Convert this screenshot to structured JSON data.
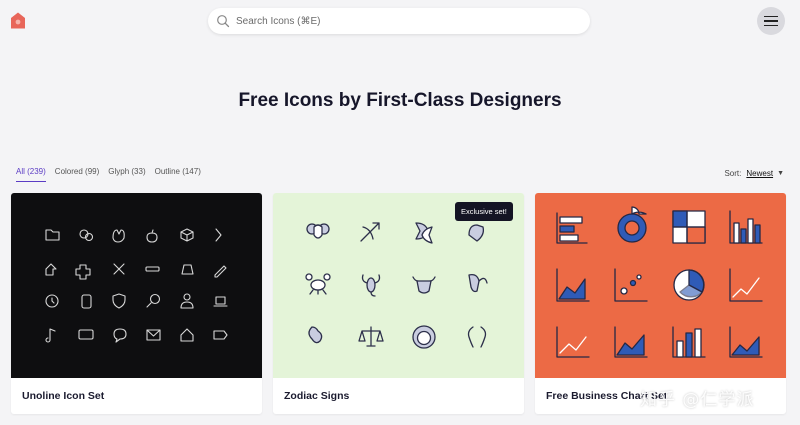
{
  "header": {
    "search_placeholder": "Search Icons (⌘E)"
  },
  "page": {
    "title": "Free Icons by First-Class Designers"
  },
  "filters": [
    {
      "label": "All (239)",
      "active": true
    },
    {
      "label": "Colored (99)",
      "active": false
    },
    {
      "label": "Glyph (33)",
      "active": false
    },
    {
      "label": "Outline (147)",
      "active": false
    }
  ],
  "sort": {
    "label": "Sort:",
    "value": "Newest"
  },
  "cards": [
    {
      "title": "Unoline Icon Set",
      "bg": "#0e0e10"
    },
    {
      "title": "Zodiac Signs",
      "bg": "#e4f4d8",
      "tooltip": "Exclusive set!"
    },
    {
      "title": "Free Business Chart Set",
      "bg": "#ec6a45"
    }
  ],
  "watermark": "知乎 @仁学派",
  "colors": {
    "accent": "#5b3cc4",
    "logo": "#e8665a"
  }
}
